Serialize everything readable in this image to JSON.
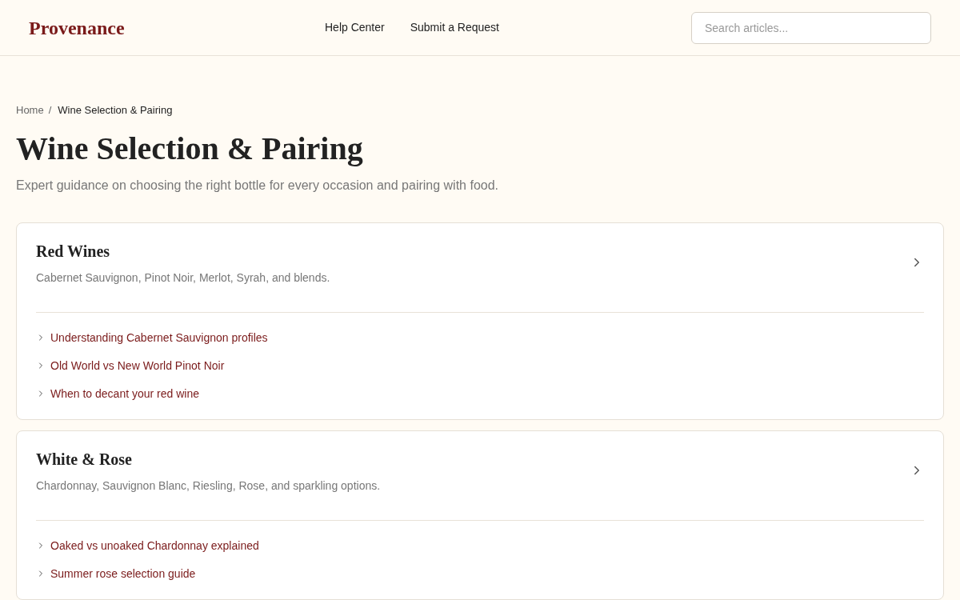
{
  "header": {
    "logo": "Provenance",
    "nav": [
      "Help Center",
      "Submit a Request"
    ],
    "search": {
      "placeholder": "Search articles..."
    }
  },
  "breadcrumb": {
    "items": [
      "Home"
    ],
    "separator": "/",
    "current": "Wine Selection & Pairing"
  },
  "title": "Wine Selection & Pairing",
  "subtitle": "Expert guidance on choosing the right bottle for every occasion and pairing with food.",
  "categories": [
    {
      "title": "Red Wines",
      "description": "Cabernet Sauvignon, Pinot Noir, Merlot, Syrah, and blends.",
      "articles": [
        "Understanding Cabernet Sauvignon profiles",
        "Old World vs New World Pinot Noir",
        "When to decant your red wine"
      ]
    },
    {
      "title": "White & Rose",
      "description": "Chardonnay, Sauvignon Blanc, Riesling, Rose, and sparkling options.",
      "articles": [
        "Oaked vs unoaked Chardonnay explained",
        "Summer rose selection guide"
      ]
    }
  ]
}
